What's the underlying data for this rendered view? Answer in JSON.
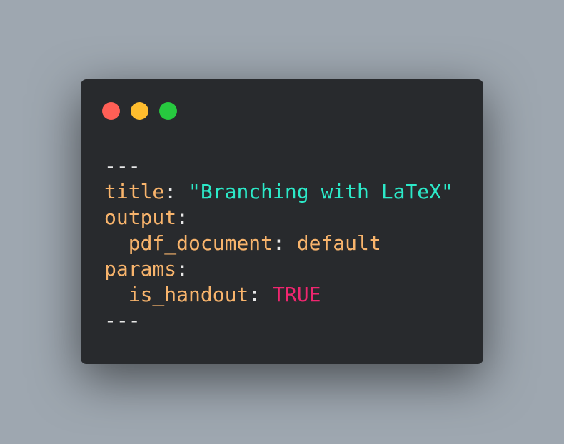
{
  "window": {
    "controls": [
      {
        "name": "close",
        "color": "#ff5f56"
      },
      {
        "name": "minimize",
        "color": "#ffbd2e"
      },
      {
        "name": "maximize",
        "color": "#27c93f"
      }
    ]
  },
  "code": {
    "lines": [
      {
        "indent": "",
        "key": "",
        "sep": "---",
        "value": ""
      },
      {
        "indent": "",
        "key": "title",
        "sep": ": ",
        "value": "\"Branching with LaTeX\""
      },
      {
        "indent": "",
        "key": "output",
        "sep": ":",
        "value": ""
      },
      {
        "indent": "  ",
        "key": "pdf_document",
        "sep": ": ",
        "value": "default"
      },
      {
        "indent": "",
        "key": "params",
        "sep": ":",
        "value": ""
      },
      {
        "indent": "  ",
        "key": "is_handout",
        "sep": ": ",
        "value": "TRUE"
      },
      {
        "indent": "",
        "key": "",
        "sep": "---",
        "value": ""
      }
    ]
  }
}
